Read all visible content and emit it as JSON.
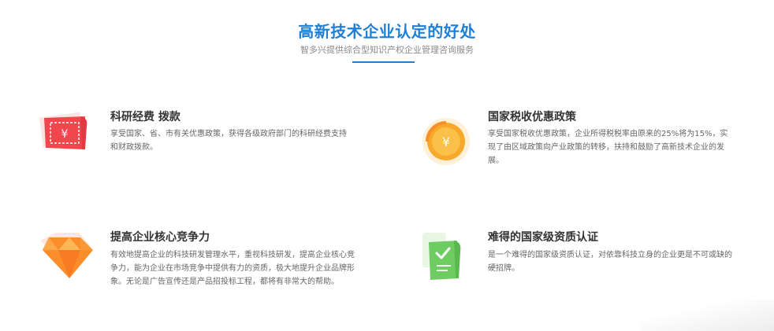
{
  "header": {
    "title": "高新技术企业认定的好处",
    "subtitle": "智多兴提供综合型知识产权企业管理咨询服务"
  },
  "features": [
    {
      "title": "科研经费 拨款",
      "description": "享受国家、省、市有关优惠政策，获得各级政府部门的科研经费支持和财政拨款。",
      "icon": "money-bill-icon"
    },
    {
      "title": "国家税收优惠政策",
      "description": "享受国家税收优惠政策，企业所得税税率由原来的25%将为15%，实现了由区域政策向产业政策的转移，扶持和鼓励了高新技术企业的发展。",
      "icon": "yuan-coin-icon"
    },
    {
      "title": "提高企业核心竞争力",
      "description": "有效地提高企业的科技研发管理水平，重视科技研发，提高企业核心竞争力，能为企业在市场竞争中提供有力的资质，极大地提升企业品牌形象。无论是广告宣传还是产品招投标工程，都将有非常大的帮助。",
      "icon": "diamond-icon"
    },
    {
      "title": "难得的国家级资质认证",
      "description": "是一个难得的国家级资质认证，对依靠科技立身的企业更是不可或缺的硬招牌。",
      "icon": "certificate-icon"
    }
  ],
  "colors": {
    "accent": "#1f7fd8",
    "bill_red": "#f0474d",
    "coin_orange": "#f8a82a",
    "diamond_orange": "#fb8d2a",
    "cert_green": "#6fcc63"
  }
}
